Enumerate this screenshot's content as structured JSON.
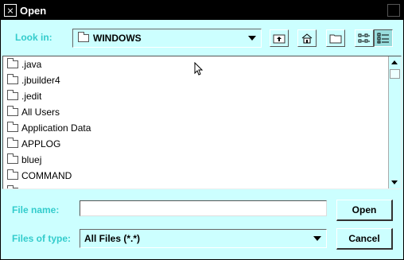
{
  "window": {
    "title": "Open"
  },
  "lookin": {
    "label": "Look in:",
    "value": "WINDOWS"
  },
  "toolbar": {
    "up_icon": "up-folder-icon",
    "home_icon": "home-icon",
    "newfolder_icon": "new-folder-icon",
    "list_icon": "list-view-icon",
    "details_icon": "details-view-icon"
  },
  "files": [
    ".java",
    ".jbuilder4",
    ".jedit",
    "All Users",
    "Application Data",
    "APPLOG",
    "bluej",
    "COMMAND"
  ],
  "filename": {
    "label": "File name:",
    "value": ""
  },
  "filetype": {
    "label": "Files of type:",
    "value": "All Files (*.*)"
  },
  "buttons": {
    "open": "Open",
    "cancel": "Cancel"
  },
  "colors": {
    "background": "#ccffff",
    "label": "#33cccc",
    "titlebar": "#000000"
  }
}
